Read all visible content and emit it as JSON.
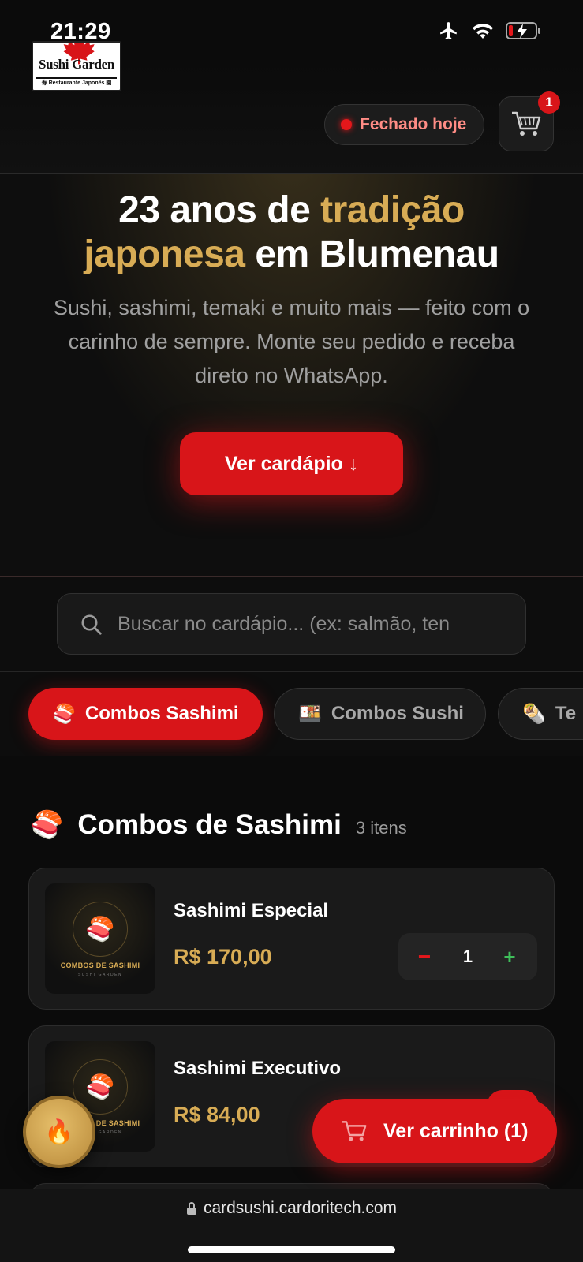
{
  "status_bar": {
    "time": "21:29"
  },
  "header": {
    "logo": {
      "name": "Sushi Garden",
      "subtitle": "寿 Restaurante Japonês 園"
    },
    "status_label": "Fechado hoje",
    "cart_count": "1"
  },
  "hero": {
    "title_line1_white": "23 anos de ",
    "title_line1_gold": "tradição",
    "title_line2_gold": "japonesa",
    "title_line2_white": " em Blumenau",
    "subtitle": "Sushi, sashimi, temaki e muito mais — feito com o carinho de sempre. Monte seu pedido e receba direto no WhatsApp.",
    "cta_label": "Ver cardápio ↓"
  },
  "search": {
    "placeholder": "Buscar no cardápio... (ex: salmão, ten"
  },
  "tabs": [
    {
      "icon": "🍣",
      "label": "Combos Sashimi",
      "active": true
    },
    {
      "icon": "🍱",
      "label": "Combos Sushi",
      "active": false
    },
    {
      "icon": "🌯",
      "label": "Te",
      "active": false
    }
  ],
  "section": {
    "emoji": "🍣",
    "title": "Combos de Sashimi",
    "count": "3 itens"
  },
  "items": [
    {
      "name": "Sashimi Especial",
      "price": "R$ 170,00",
      "qty": "1",
      "thumb_title": "COMBOS DE SASHIMI",
      "thumb_sub": "SUSHI GARDEN"
    },
    {
      "name": "Sashimi Executivo",
      "price": "R$ 84,00",
      "thumb_title": "COMBOS DE SASHIMI",
      "thumb_sub": "SUSHI GARDEN"
    }
  ],
  "floating": {
    "fire_icon": "🔥",
    "cart_label": "Ver carrinho (1)"
  },
  "url_bar": {
    "url": "cardsushi.cardoritech.com"
  },
  "colors": {
    "accent_red": "#d81519",
    "gold": "#d8ac55",
    "background": "#0b0b0b"
  }
}
